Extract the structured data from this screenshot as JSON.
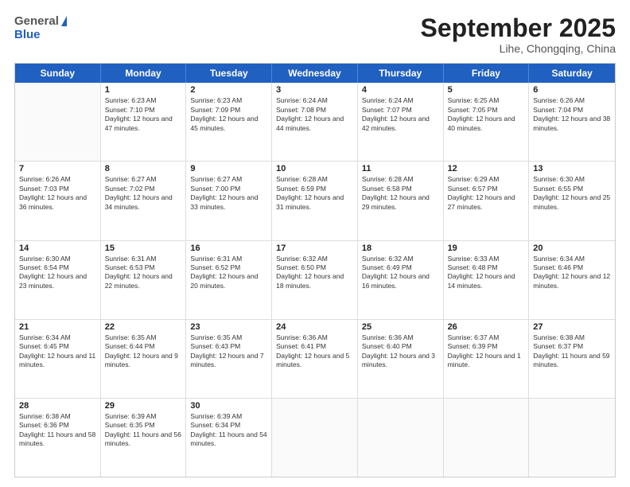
{
  "header": {
    "logo_general": "General",
    "logo_blue": "Blue",
    "title": "September 2025",
    "location": "Lihe, Chongqing, China"
  },
  "days": [
    "Sunday",
    "Monday",
    "Tuesday",
    "Wednesday",
    "Thursday",
    "Friday",
    "Saturday"
  ],
  "weeks": [
    [
      {
        "day": "",
        "sunrise": "",
        "sunset": "",
        "daylight": ""
      },
      {
        "day": "1",
        "sunrise": "Sunrise: 6:23 AM",
        "sunset": "Sunset: 7:10 PM",
        "daylight": "Daylight: 12 hours and 47 minutes."
      },
      {
        "day": "2",
        "sunrise": "Sunrise: 6:23 AM",
        "sunset": "Sunset: 7:09 PM",
        "daylight": "Daylight: 12 hours and 45 minutes."
      },
      {
        "day": "3",
        "sunrise": "Sunrise: 6:24 AM",
        "sunset": "Sunset: 7:08 PM",
        "daylight": "Daylight: 12 hours and 44 minutes."
      },
      {
        "day": "4",
        "sunrise": "Sunrise: 6:24 AM",
        "sunset": "Sunset: 7:07 PM",
        "daylight": "Daylight: 12 hours and 42 minutes."
      },
      {
        "day": "5",
        "sunrise": "Sunrise: 6:25 AM",
        "sunset": "Sunset: 7:05 PM",
        "daylight": "Daylight: 12 hours and 40 minutes."
      },
      {
        "day": "6",
        "sunrise": "Sunrise: 6:26 AM",
        "sunset": "Sunset: 7:04 PM",
        "daylight": "Daylight: 12 hours and 38 minutes."
      }
    ],
    [
      {
        "day": "7",
        "sunrise": "Sunrise: 6:26 AM",
        "sunset": "Sunset: 7:03 PM",
        "daylight": "Daylight: 12 hours and 36 minutes."
      },
      {
        "day": "8",
        "sunrise": "Sunrise: 6:27 AM",
        "sunset": "Sunset: 7:02 PM",
        "daylight": "Daylight: 12 hours and 34 minutes."
      },
      {
        "day": "9",
        "sunrise": "Sunrise: 6:27 AM",
        "sunset": "Sunset: 7:00 PM",
        "daylight": "Daylight: 12 hours and 33 minutes."
      },
      {
        "day": "10",
        "sunrise": "Sunrise: 6:28 AM",
        "sunset": "Sunset: 6:59 PM",
        "daylight": "Daylight: 12 hours and 31 minutes."
      },
      {
        "day": "11",
        "sunrise": "Sunrise: 6:28 AM",
        "sunset": "Sunset: 6:58 PM",
        "daylight": "Daylight: 12 hours and 29 minutes."
      },
      {
        "day": "12",
        "sunrise": "Sunrise: 6:29 AM",
        "sunset": "Sunset: 6:57 PM",
        "daylight": "Daylight: 12 hours and 27 minutes."
      },
      {
        "day": "13",
        "sunrise": "Sunrise: 6:30 AM",
        "sunset": "Sunset: 6:55 PM",
        "daylight": "Daylight: 12 hours and 25 minutes."
      }
    ],
    [
      {
        "day": "14",
        "sunrise": "Sunrise: 6:30 AM",
        "sunset": "Sunset: 6:54 PM",
        "daylight": "Daylight: 12 hours and 23 minutes."
      },
      {
        "day": "15",
        "sunrise": "Sunrise: 6:31 AM",
        "sunset": "Sunset: 6:53 PM",
        "daylight": "Daylight: 12 hours and 22 minutes."
      },
      {
        "day": "16",
        "sunrise": "Sunrise: 6:31 AM",
        "sunset": "Sunset: 6:52 PM",
        "daylight": "Daylight: 12 hours and 20 minutes."
      },
      {
        "day": "17",
        "sunrise": "Sunrise: 6:32 AM",
        "sunset": "Sunset: 6:50 PM",
        "daylight": "Daylight: 12 hours and 18 minutes."
      },
      {
        "day": "18",
        "sunrise": "Sunrise: 6:32 AM",
        "sunset": "Sunset: 6:49 PM",
        "daylight": "Daylight: 12 hours and 16 minutes."
      },
      {
        "day": "19",
        "sunrise": "Sunrise: 6:33 AM",
        "sunset": "Sunset: 6:48 PM",
        "daylight": "Daylight: 12 hours and 14 minutes."
      },
      {
        "day": "20",
        "sunrise": "Sunrise: 6:34 AM",
        "sunset": "Sunset: 6:46 PM",
        "daylight": "Daylight: 12 hours and 12 minutes."
      }
    ],
    [
      {
        "day": "21",
        "sunrise": "Sunrise: 6:34 AM",
        "sunset": "Sunset: 6:45 PM",
        "daylight": "Daylight: 12 hours and 11 minutes."
      },
      {
        "day": "22",
        "sunrise": "Sunrise: 6:35 AM",
        "sunset": "Sunset: 6:44 PM",
        "daylight": "Daylight: 12 hours and 9 minutes."
      },
      {
        "day": "23",
        "sunrise": "Sunrise: 6:35 AM",
        "sunset": "Sunset: 6:43 PM",
        "daylight": "Daylight: 12 hours and 7 minutes."
      },
      {
        "day": "24",
        "sunrise": "Sunrise: 6:36 AM",
        "sunset": "Sunset: 6:41 PM",
        "daylight": "Daylight: 12 hours and 5 minutes."
      },
      {
        "day": "25",
        "sunrise": "Sunrise: 6:36 AM",
        "sunset": "Sunset: 6:40 PM",
        "daylight": "Daylight: 12 hours and 3 minutes."
      },
      {
        "day": "26",
        "sunrise": "Sunrise: 6:37 AM",
        "sunset": "Sunset: 6:39 PM",
        "daylight": "Daylight: 12 hours and 1 minute."
      },
      {
        "day": "27",
        "sunrise": "Sunrise: 6:38 AM",
        "sunset": "Sunset: 6:37 PM",
        "daylight": "Daylight: 11 hours and 59 minutes."
      }
    ],
    [
      {
        "day": "28",
        "sunrise": "Sunrise: 6:38 AM",
        "sunset": "Sunset: 6:36 PM",
        "daylight": "Daylight: 11 hours and 58 minutes."
      },
      {
        "day": "29",
        "sunrise": "Sunrise: 6:39 AM",
        "sunset": "Sunset: 6:35 PM",
        "daylight": "Daylight: 11 hours and 56 minutes."
      },
      {
        "day": "30",
        "sunrise": "Sunrise: 6:39 AM",
        "sunset": "Sunset: 6:34 PM",
        "daylight": "Daylight: 11 hours and 54 minutes."
      },
      {
        "day": "",
        "sunrise": "",
        "sunset": "",
        "daylight": ""
      },
      {
        "day": "",
        "sunrise": "",
        "sunset": "",
        "daylight": ""
      },
      {
        "day": "",
        "sunrise": "",
        "sunset": "",
        "daylight": ""
      },
      {
        "day": "",
        "sunrise": "",
        "sunset": "",
        "daylight": ""
      }
    ]
  ]
}
